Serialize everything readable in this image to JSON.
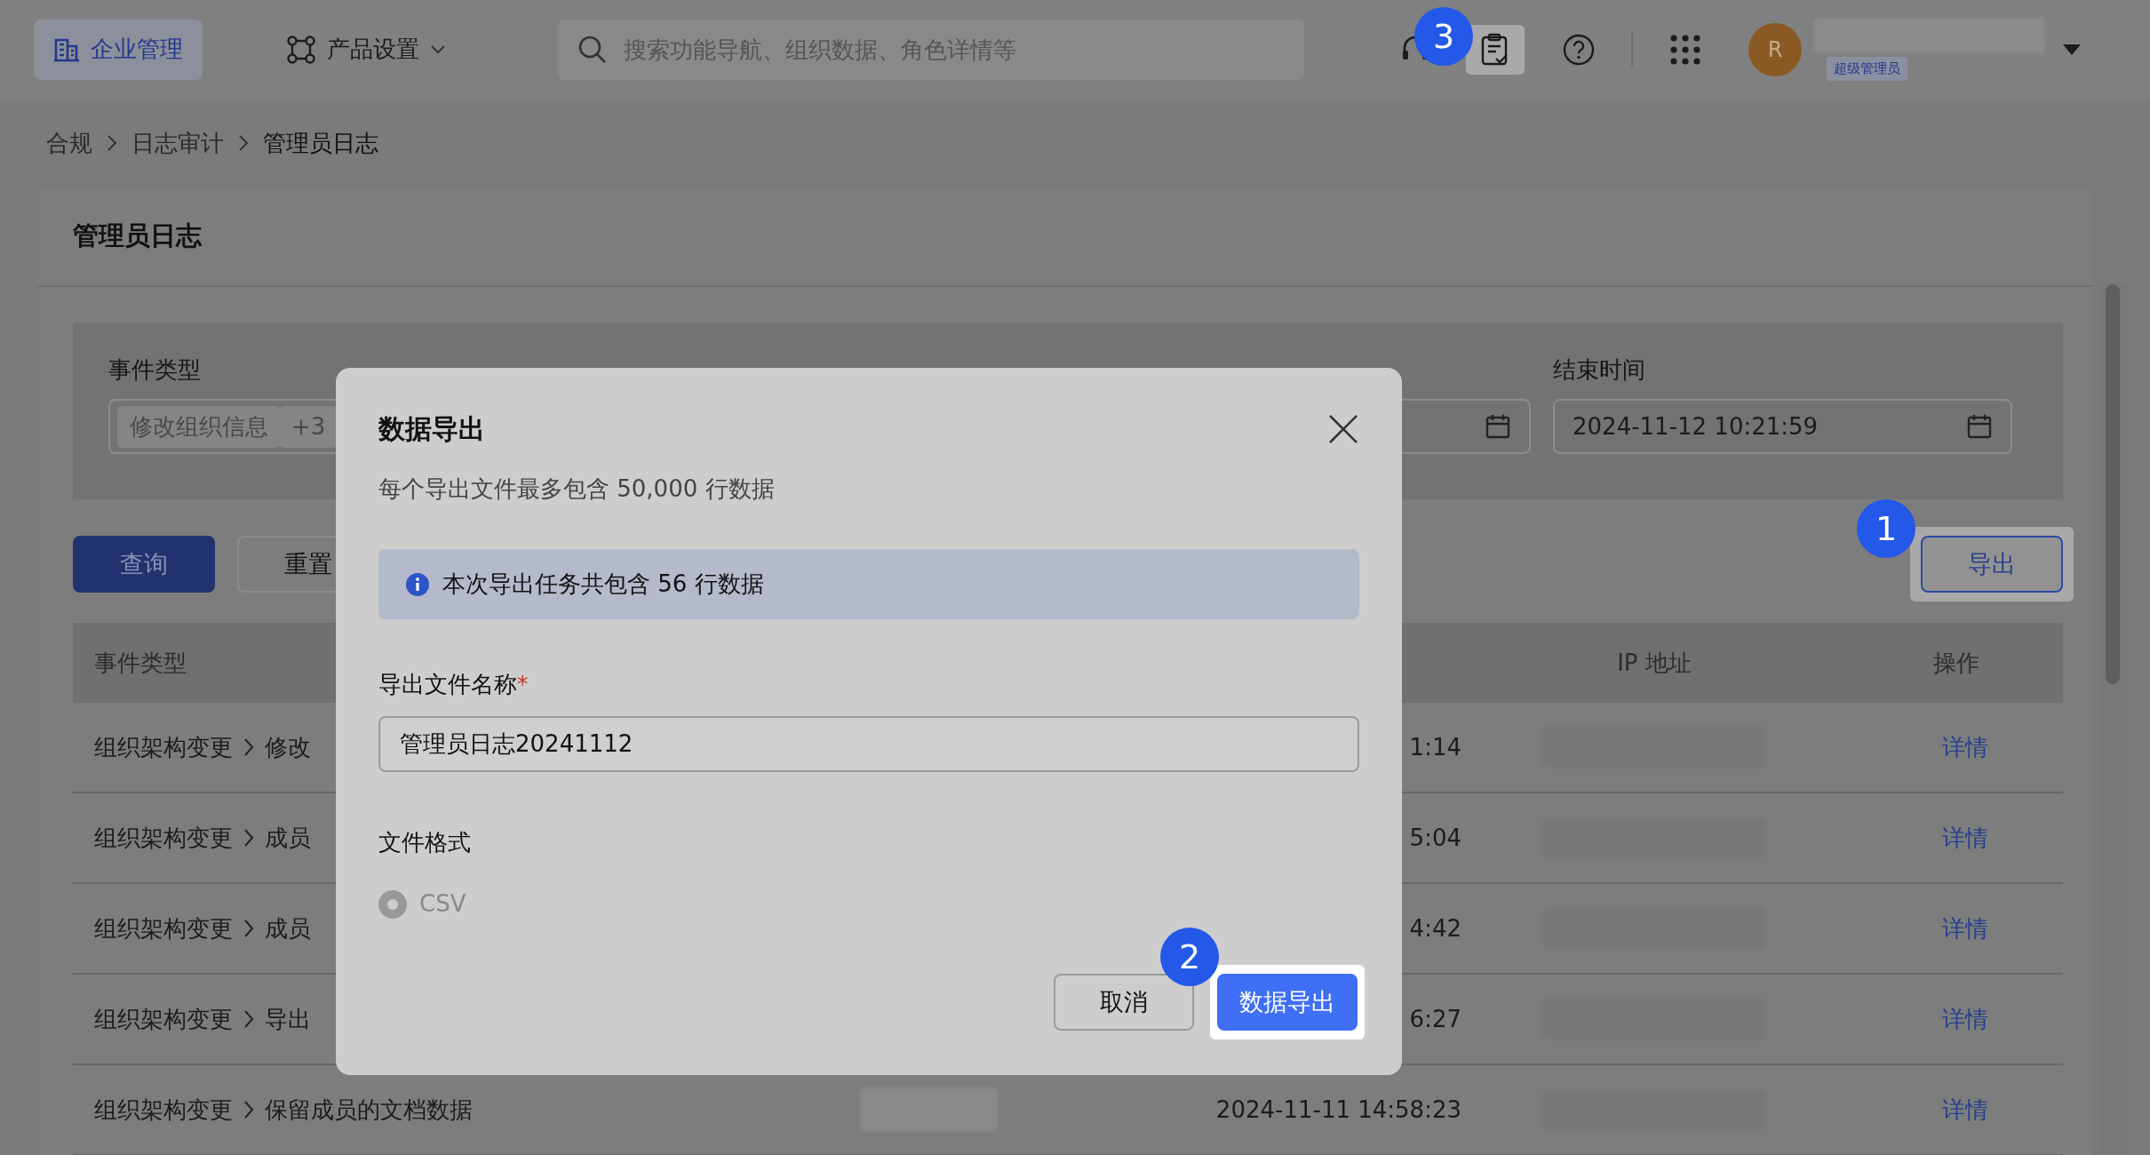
{
  "topbar": {
    "app_button": "企业管理",
    "product_menu": "产品设置",
    "search": {
      "placeholder": "搜索功能导航、组织数据、角色详情等"
    },
    "tasks_icon": {
      "highlighted": true,
      "callout": "3"
    },
    "avatar": "R",
    "role_badge": "超级管理员"
  },
  "breadcrumb": [
    "合规",
    "日志审计",
    "管理员日志"
  ],
  "card_title": "管理员日志",
  "filters": [
    {
      "kind": "tags",
      "label": "事件类型",
      "tags": [
        "修改组织信息",
        "+3"
      ]
    },
    {
      "kind": "covered"
    },
    {
      "kind": "date"
    },
    {
      "kind": "date",
      "label": "结束时间",
      "value": "2024-11-12 10:21:59"
    }
  ],
  "actions": [
    {
      "kind": "primary",
      "label": "查询"
    },
    {
      "kind": "outline",
      "label": "重置"
    }
  ],
  "export_button": {
    "label": "导出",
    "highlighted": true,
    "callout": "1"
  },
  "table": {
    "columns": [
      "事件类型",
      "IP 地址",
      "操作"
    ],
    "rows": [
      {
        "category": "组织架构变更",
        "event": "修改",
        "time": "1:14",
        "action": "详情"
      },
      {
        "category": "组织架构变更",
        "event": "成员",
        "time": "5:04",
        "action": "详情"
      },
      {
        "category": "组织架构变更",
        "event": "成员",
        "time": "4:42",
        "action": "详情"
      },
      {
        "category": "组织架构变更",
        "event": "导出",
        "time": "6:27",
        "action": "详情"
      },
      {
        "category": "组织架构变更",
        "event": "保留成员的文档数据",
        "admin_redacted": true,
        "time": "2024-11-11 14:58:23",
        "action": "详情"
      }
    ]
  },
  "modal": {
    "title": "数据导出",
    "subtitle": "每个导出文件最多包含 50,000 行数据",
    "alert": "本次导出任务共包含 56 行数据",
    "name_label": "导出文件名称",
    "name_required_mark": "*",
    "name_value": "管理员日志20241112",
    "format_label": "文件格式",
    "formats": [
      {
        "label": "CSV",
        "selected": true,
        "disabled": true
      }
    ],
    "cancel": "取消",
    "confirm": {
      "label": "数据导出",
      "highlighted": true,
      "callout": "2"
    }
  }
}
